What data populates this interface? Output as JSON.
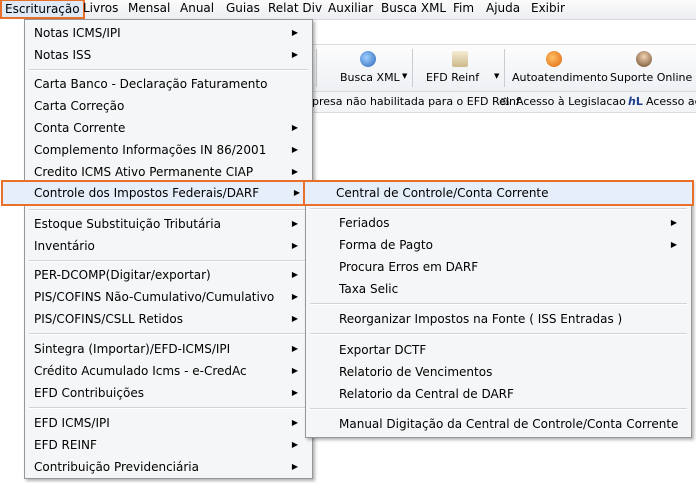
{
  "menubar": {
    "items": [
      "Escrituração",
      "Livros",
      "Mensal",
      "Anual",
      "Guias",
      "Relat Div",
      "Auxiliar",
      "Busca XML",
      "Fim",
      "Ajuda",
      "Exibir"
    ]
  },
  "toolbar": {
    "buttons": [
      {
        "label": "Busca XML",
        "icon": "busca-xml-icon",
        "color": "#3b79c6"
      },
      {
        "label": "EFD Reinf",
        "icon": "efd-reinf-icon",
        "color": "#d8c79a"
      },
      {
        "label": "Autoatendimento",
        "icon": "autoatendimento-icon",
        "color": "#f08a1c"
      },
      {
        "label": "Suporte Online",
        "icon": "suporte-online-icon",
        "color": "#8a6a4a"
      }
    ]
  },
  "status_strip": {
    "message": "presa não habilitada para o EFD Reinf",
    "acesso_legislacao": "Acesso à Legislacao",
    "acesso_ac": "Acesso ac"
  },
  "menu_escrituracao": [
    {
      "label": "Notas ICMS/IPI",
      "submenu": true
    },
    {
      "label": "Notas ISS",
      "submenu": true
    },
    {
      "label": "Carta Banco - Declaração Faturamento",
      "submenu": false
    },
    {
      "label": "Carta Correção",
      "submenu": false
    },
    {
      "label": "Conta Corrente",
      "submenu": true
    },
    {
      "label": "Complemento Informações IN 86/2001",
      "submenu": true
    },
    {
      "label": "Credito ICMS Ativo Permanente CIAP",
      "submenu": true
    },
    {
      "label": "Controle dos Impostos Federais/DARF",
      "submenu": true
    },
    {
      "label": "Estoque Substituição Tributária",
      "submenu": true
    },
    {
      "label": "Inventário",
      "submenu": true
    },
    {
      "label": "PER-DCOMP(Digitar/exportar)",
      "submenu": true
    },
    {
      "label": "PIS/COFINS Não-Cumulativo/Cumulativo",
      "submenu": true
    },
    {
      "label": "PIS/COFINS/CSLL Retidos",
      "submenu": true
    },
    {
      "label": "Sintegra (Importar)/EFD-ICMS/IPI",
      "submenu": true
    },
    {
      "label": "Crédito Acumulado Icms - e-CredAc",
      "submenu": true
    },
    {
      "label": "EFD Contribuições",
      "submenu": true
    },
    {
      "label": "EFD ICMS/IPI",
      "submenu": true
    },
    {
      "label": "EFD REINF",
      "submenu": true
    },
    {
      "label": "Contribuição Previdenciária",
      "submenu": true
    }
  ],
  "submenu_darf": [
    {
      "label": "Central de Controle/Conta Corrente",
      "submenu": false
    },
    {
      "label": "Feriados",
      "submenu": true
    },
    {
      "label": "Forma de Pagto",
      "submenu": true
    },
    {
      "label": "Procura Erros em DARF",
      "submenu": false
    },
    {
      "label": "Taxa Selic",
      "submenu": false
    },
    {
      "label": "Reorganizar Impostos na Fonte ( ISS Entradas )",
      "submenu": false
    },
    {
      "label": "Exportar DCTF",
      "submenu": false
    },
    {
      "label": "Relatorio de Vencimentos",
      "submenu": false
    },
    {
      "label": "Relatorio da Central de DARF",
      "submenu": false
    },
    {
      "label": "Manual Digitação da Central de Controle/Conta Corrente",
      "submenu": false
    }
  ],
  "colors": {
    "highlight_border": "#e8702a",
    "highlight_fill": "#e6eefa"
  }
}
